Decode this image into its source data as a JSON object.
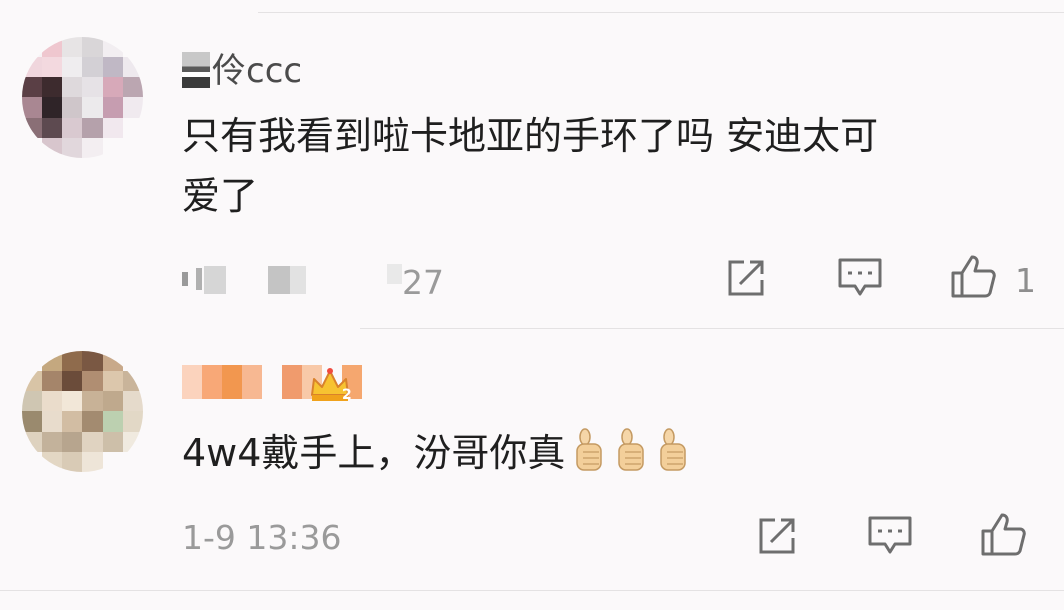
{
  "comments": [
    {
      "username": "伶ccc",
      "text_line1": "只有我看到啦卡地亚的手环了吗  安迪太可",
      "text_line2": "爱了",
      "time_suffix": "27",
      "like_count": "1"
    },
    {
      "username": "",
      "text": "4w4戴手上，汾哥你真",
      "time": "1-9 13:36"
    }
  ],
  "icons": {
    "share": "share-icon",
    "comment": "comment-icon",
    "like": "thumbs-up-icon",
    "badge": "crown-badge-icon",
    "emoji": "thumbs-up-emoji"
  },
  "colors": {
    "background": "#fbf9fa",
    "text": "#1f1f1f",
    "meta": "#9a9a9a",
    "icon": "#6e6e6e",
    "divider": "#e4e2e3",
    "badge": "#f0a21b"
  }
}
